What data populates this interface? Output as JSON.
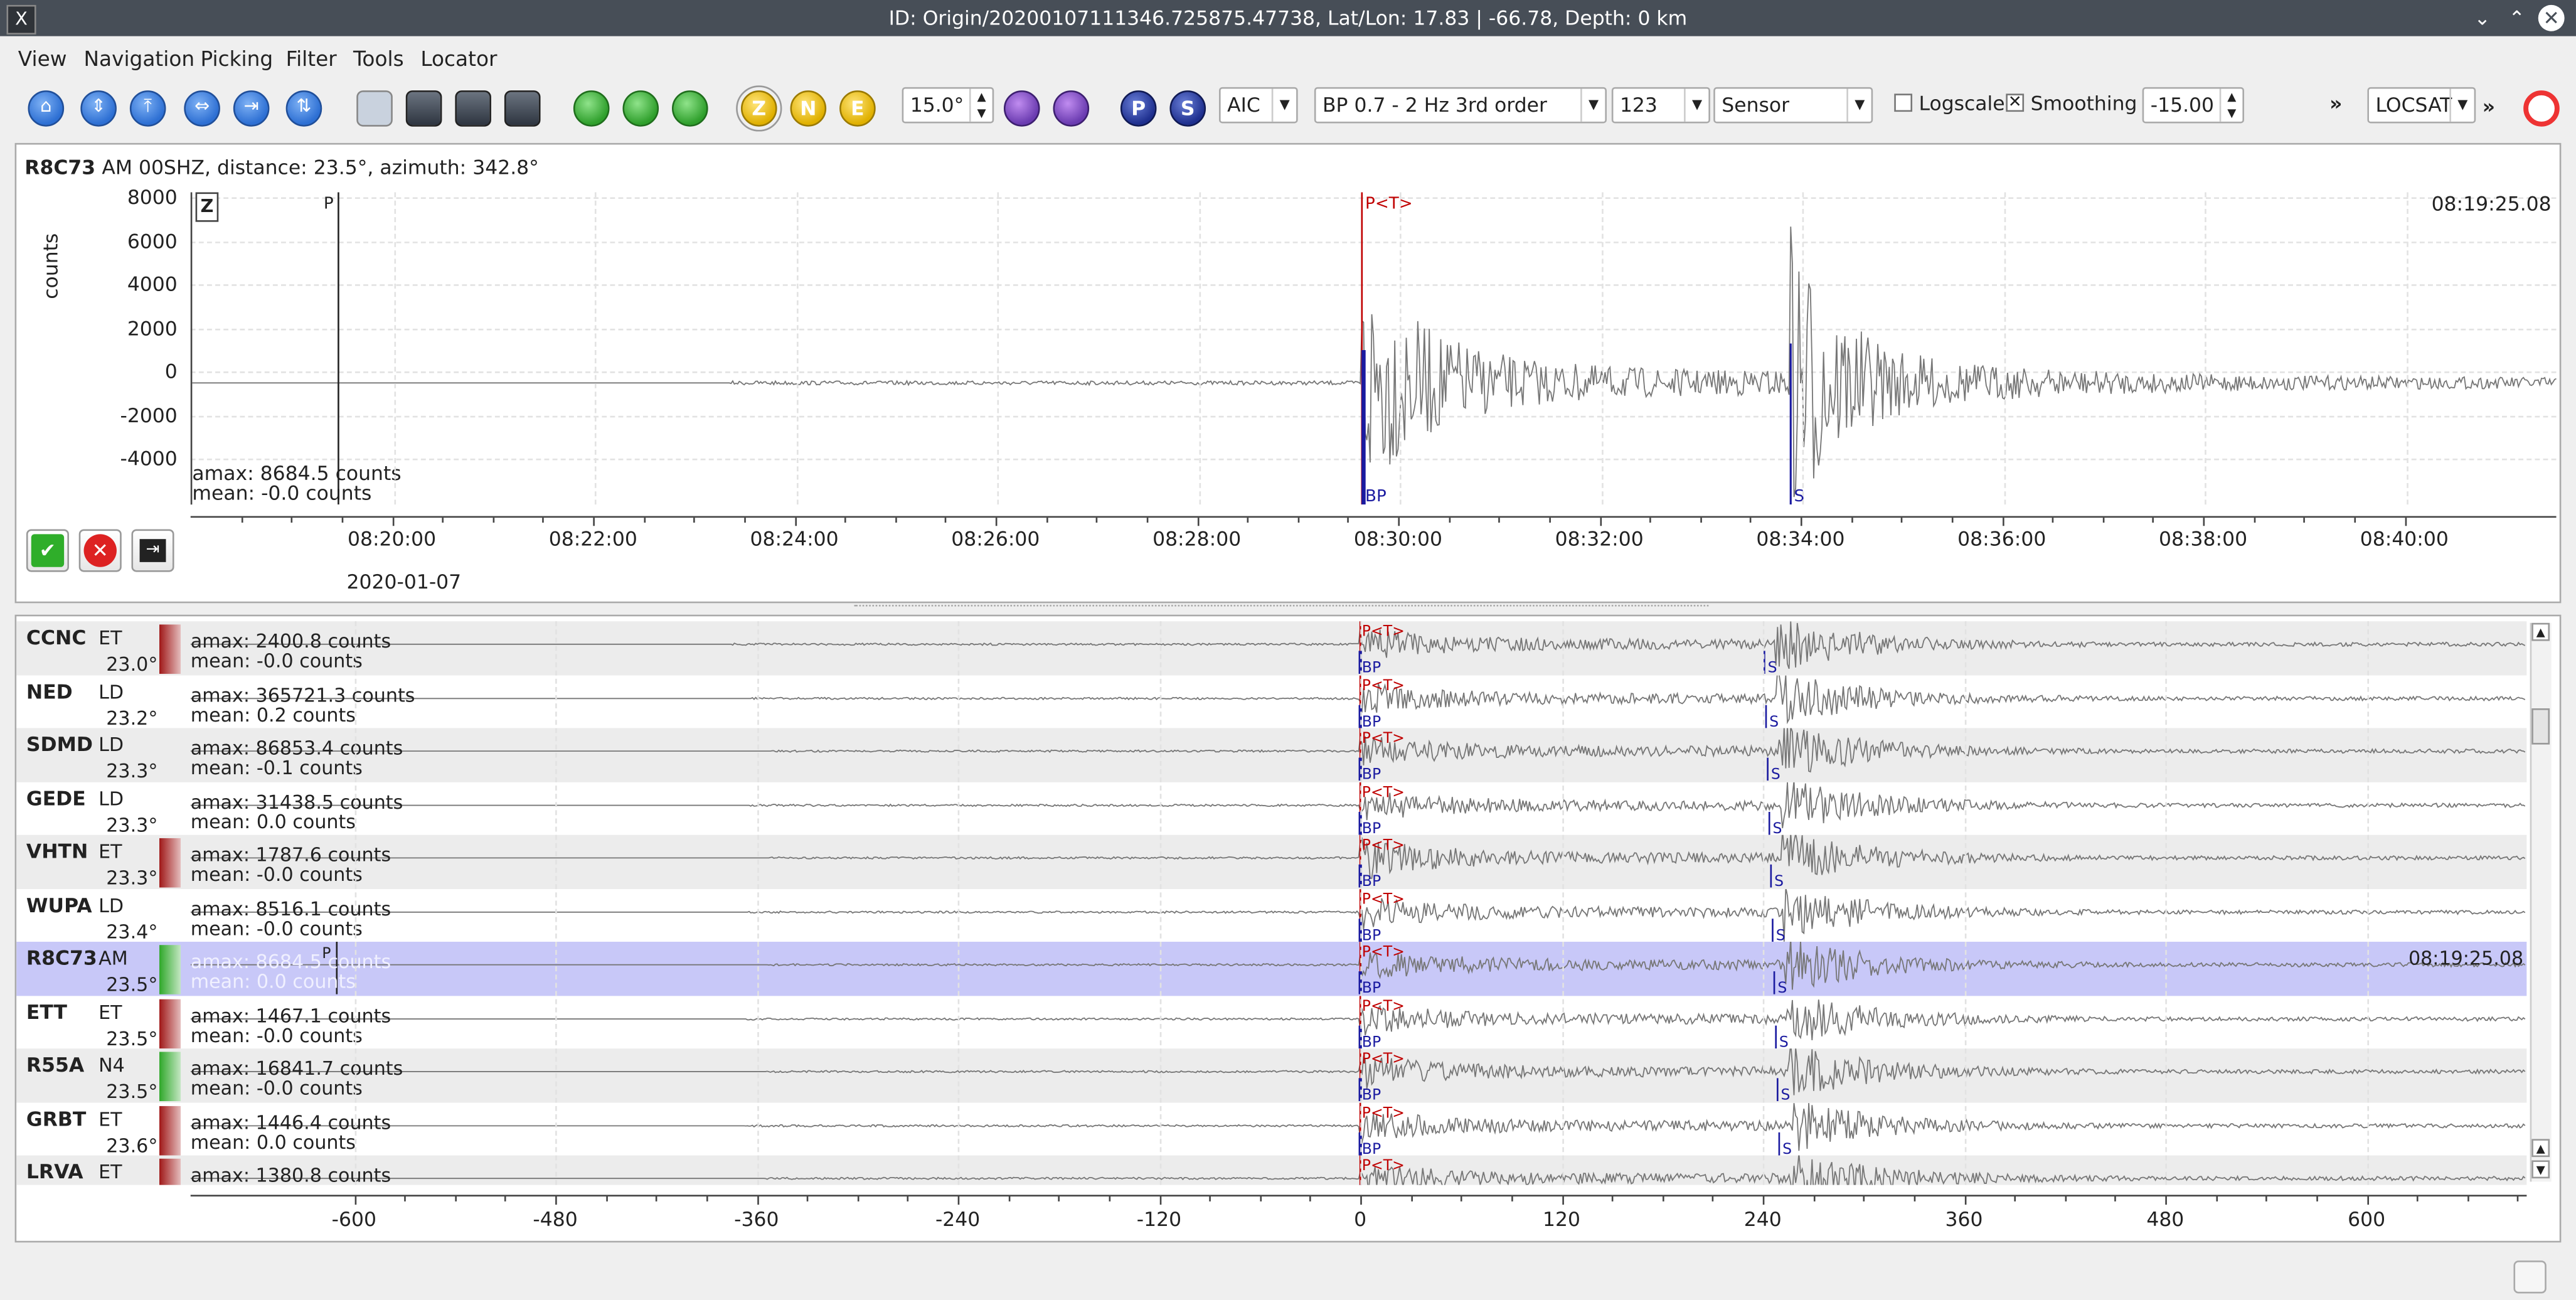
{
  "window": {
    "title": "ID: Origin/20200107111346.725875.47738, Lat/Lon: 17.83 | -66.78, Depth: 0 km",
    "logo": "X"
  },
  "menu": [
    "View",
    "Navigation",
    "Picking",
    "Filter",
    "Tools",
    "Locator"
  ],
  "toolbar": {
    "component_z": "Z",
    "component_n": "N",
    "component_e": "E",
    "angle_value": "15.0°",
    "pick_p": "P",
    "pick_s": "S",
    "picker_method": "AIC",
    "filter": "BP 0.7 - 2 Hz  3rd order",
    "rotation": "123",
    "unit_mode": "Sensor",
    "logscale_label": "Logscale",
    "logscale_checked": false,
    "smoothing_label": "Smoothing",
    "smoothing_checked": true,
    "smoothing_value": "-15.00",
    "more": "»",
    "locator": "LOCSAT",
    "more2": "»"
  },
  "detail": {
    "station": "R8C73",
    "info": "AM  00SHZ, distance: 23.5°, azimuth: 342.8°",
    "component": "Z",
    "ylabel": "counts",
    "yticks": [
      "8000",
      "6000",
      "4000",
      "2000",
      "0",
      "-2000",
      "-4000"
    ],
    "timestamp": "08:19:25.08",
    "amax": "amax: 8684.5 counts",
    "mean": "mean: -0.0 counts",
    "xticks": [
      "08:20:00",
      "08:22:00",
      "08:24:00",
      "08:26:00",
      "08:28:00",
      "08:30:00",
      "08:32:00",
      "08:34:00",
      "08:36:00",
      "08:38:00",
      "08:40:00"
    ],
    "date": "2020-01-07",
    "picks": {
      "p_label": "P",
      "pt_label": "P<T>",
      "bp_label": "BP",
      "s_label": "S"
    }
  },
  "traces": [
    {
      "station": "CCNC",
      "net": "ET",
      "dist": "23.0°",
      "amax": "amax: 2400.8 counts",
      "mean": "mean: -0.0 counts",
      "status_color": "#a01818"
    },
    {
      "station": "NED",
      "net": "LD",
      "dist": "23.2°",
      "amax": "amax: 365721.3 counts",
      "mean": "mean: 0.2 counts",
      "status_color": ""
    },
    {
      "station": "SDMD",
      "net": "LD",
      "dist": "23.3°",
      "amax": "amax: 86853.4 counts",
      "mean": "mean: -0.1 counts",
      "status_color": ""
    },
    {
      "station": "GEDE",
      "net": "LD",
      "dist": "23.3°",
      "amax": "amax: 31438.5 counts",
      "mean": "mean: 0.0 counts",
      "status_color": ""
    },
    {
      "station": "VHTN",
      "net": "ET",
      "dist": "23.3°",
      "amax": "amax: 1787.6 counts",
      "mean": "mean: -0.0 counts",
      "status_color": "#a01818"
    },
    {
      "station": "WUPA",
      "net": "LD",
      "dist": "23.4°",
      "amax": "amax: 8516.1 counts",
      "mean": "mean: -0.0 counts",
      "status_color": ""
    },
    {
      "station": "R8C73",
      "net": "AM",
      "dist": "23.5°",
      "amax": "amax: 8684.5 counts",
      "mean": "mean: 0.0 counts",
      "status_color": "#2fa82a",
      "selected": true,
      "timestamp": "08:19:25.08"
    },
    {
      "station": "ETT",
      "net": "ET",
      "dist": "23.5°",
      "amax": "amax: 1467.1 counts",
      "mean": "mean: -0.0 counts",
      "status_color": "#a01818"
    },
    {
      "station": "R55A",
      "net": "N4",
      "dist": "23.5°",
      "amax": "amax: 16841.7 counts",
      "mean": "mean: -0.0 counts",
      "status_color": "#2fa82a"
    },
    {
      "station": "GRBT",
      "net": "ET",
      "dist": "23.6°",
      "amax": "amax: 1446.4 counts",
      "mean": "mean: 0.0 counts",
      "status_color": "#a01818"
    },
    {
      "station": "LRVA",
      "net": "ET",
      "dist": "",
      "amax": "amax: 1380.8 counts",
      "mean": "",
      "status_color": "#a01818"
    }
  ],
  "list_xticks": [
    "-600",
    "-480",
    "-360",
    "-240",
    "-120",
    "0",
    "120",
    "240",
    "360",
    "480",
    "600"
  ],
  "colors": {
    "p_theoretical": "#c00000",
    "pick_blue": "#1a1aa0",
    "selected_row": "#c8c8f8",
    "wave": "#777777"
  }
}
